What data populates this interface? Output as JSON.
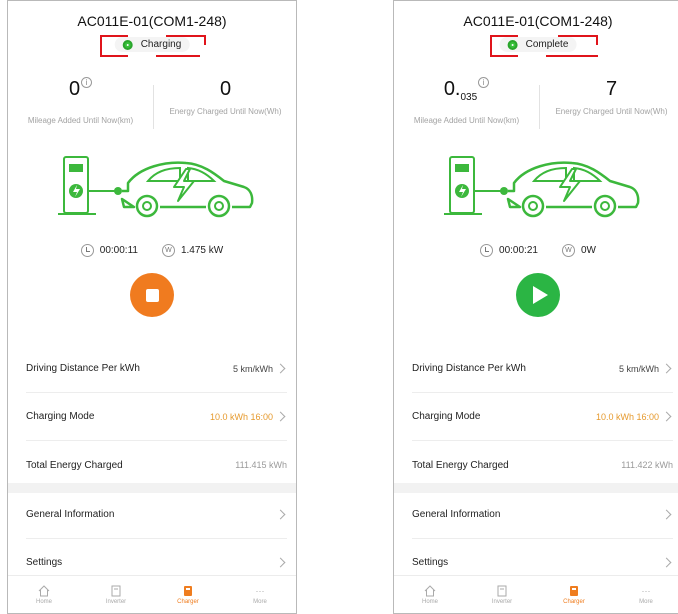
{
  "screens": [
    {
      "device_title": "AC011E-01(COM1-248)",
      "status": "Charging",
      "mileage": {
        "value_main": "0",
        "value_sub": "",
        "label": "Mileage Added Until Now(km)"
      },
      "energy": {
        "value": "0",
        "label": "Energy Charged Until Now(Wh)"
      },
      "timer": "00:00:11",
      "power": "1.475 kW",
      "action": "stop",
      "rows": [
        {
          "label": "Driving Distance Per kWh",
          "value": "5 km/kWh"
        },
        {
          "label": "Charging Mode",
          "value": "10.0 kWh  16:00"
        },
        {
          "label": "Total Energy Charged",
          "value": "111.415 kWh"
        }
      ],
      "rows2": [
        {
          "label": "General Information"
        },
        {
          "label": "Settings"
        }
      ]
    },
    {
      "device_title": "AC011E-01(COM1-248)",
      "status": "Complete",
      "mileage": {
        "value_main": "0.",
        "value_sub": "035",
        "label": "Mileage Added Until Now(km)"
      },
      "energy": {
        "value": "7",
        "label": "Energy Charged Until Now(Wh)"
      },
      "timer": "00:00:21",
      "power": "0W",
      "action": "play",
      "rows": [
        {
          "label": "Driving Distance Per kWh",
          "value": "5 km/kWh"
        },
        {
          "label": "Charging Mode",
          "value": "10.0 kWh  16:00"
        },
        {
          "label": "Total Energy Charged",
          "value": "111.422 kWh"
        }
      ],
      "rows2": [
        {
          "label": "General Information"
        },
        {
          "label": "Settings"
        }
      ]
    }
  ],
  "tabs": [
    "Home",
    "Inverter",
    "Charger",
    "More"
  ],
  "active_tab": "Charger",
  "icons": {
    "info": "info-icon",
    "clock": "clock-icon",
    "watt": "watt-icon",
    "chevron": "chevron-right-icon"
  },
  "colors": {
    "status_green": "#37c13a",
    "stop_orange": "#f07b1f",
    "play_green": "#2bb544",
    "mode_orange": "#e69a2e",
    "annotation_red": "#e0141b",
    "car_green": "#3cb83c"
  }
}
